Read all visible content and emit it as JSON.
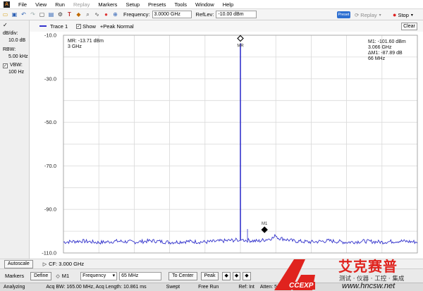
{
  "menu": {
    "logo": "A",
    "items": [
      "File",
      "View",
      "Run",
      "Replay",
      "Markers",
      "Setup",
      "Presets",
      "Tools",
      "Window",
      "Help"
    ]
  },
  "toolbar": {
    "frequency_label": "Frequency:",
    "frequency_value": "3.0000 GHz",
    "reflev_label": "RefLev:",
    "reflev_value": "-10.00 dBm",
    "preset_label": "Preset",
    "replay_label": "Replay",
    "stop_label": "Stop"
  },
  "left_panel": {
    "db_div_label": "dB/div:",
    "db_div_value": "10.0 dB",
    "rbw_label": "RBW:",
    "rbw_value": "5.00 kHz",
    "vbw_label": "VBW:",
    "vbw_value": "100 Hz"
  },
  "trace_header": {
    "trace_label": "Trace 1",
    "show_label": "Show",
    "mode_label": "+Peak Normal",
    "clear_label": "Clear"
  },
  "plot": {
    "y_ticks": [
      "-10.0",
      "-30.0",
      "-50.0",
      "-70.0",
      "-90.0",
      "-110.0"
    ],
    "mr_readout_line1": "MR: -13.71 dBm",
    "mr_readout_line2": "3 GHz",
    "m1_readout_line1": "M1: -101.60 dBm",
    "m1_readout_line2": "3.066 GHz",
    "m1_readout_line3": "ΔM1: -87.89 dB",
    "m1_readout_line4": "66 MHz",
    "mr_marker_label": "MR",
    "m1_marker_label": "M1",
    "trace_color": "#3333cc"
  },
  "chart_data": {
    "type": "line",
    "title": "",
    "xlabel": "",
    "ylabel": "",
    "ylim": [
      -110,
      -10
    ],
    "grid": true,
    "center_frequency_ghz": 3.0,
    "series": [
      {
        "name": "Trace 1",
        "x_rel_div": [
          0,
          0.5,
          1,
          1.5,
          2,
          2.5,
          3,
          3.5,
          4,
          4.5,
          4.95,
          5.0,
          5.05,
          5.5,
          5.95,
          6.0,
          6.05,
          6.5,
          7,
          7.5,
          8,
          8.5,
          9,
          9.5,
          10
        ],
        "values_dbm": [
          -105,
          -104.5,
          -105.2,
          -104.6,
          -105,
          -104.4,
          -105.1,
          -104.7,
          -105,
          -104.5,
          -104,
          -13.71,
          -104,
          -104.6,
          -103,
          -101.6,
          -103,
          -104.5,
          -105,
          -104.4,
          -105.1,
          -104.6,
          -105,
          -104.5,
          -105
        ]
      }
    ],
    "markers": [
      {
        "name": "MR",
        "x_rel_div": 5.0,
        "value_dbm": -13.71
      },
      {
        "name": "M1",
        "x_rel_div": 6.0,
        "value_dbm": -101.6
      }
    ]
  },
  "autoscale": {
    "button_label": "Autoscale",
    "cf_label": "CF: 3.000 GHz"
  },
  "markers_row": {
    "markers_label": "Markers",
    "define_label": "Define",
    "marker_select": "M1",
    "param_select": "Frequency",
    "param_value": "65 MHz",
    "to_center_label": "To Center",
    "peak_label": "Peak"
  },
  "status": {
    "state": "Analyzing",
    "acq": "Acq BW: 165.00 MHz, Acq Length: 10.861 ms",
    "swept": "Swept",
    "run_mode": "Free Run",
    "ref": "Ref: Int",
    "atten": "Atten: 5"
  },
  "watermark": {
    "brand_cn": "艾克赛普",
    "tagline_cn": "测试 · 仪器 · 工控 · 集成",
    "url": "www.hncsw.net",
    "logo_text": "CCEXP"
  },
  "colors": {
    "accent": "#2d6fd1",
    "trace": "#3333cc",
    "watermark_red": "#e0231e"
  }
}
